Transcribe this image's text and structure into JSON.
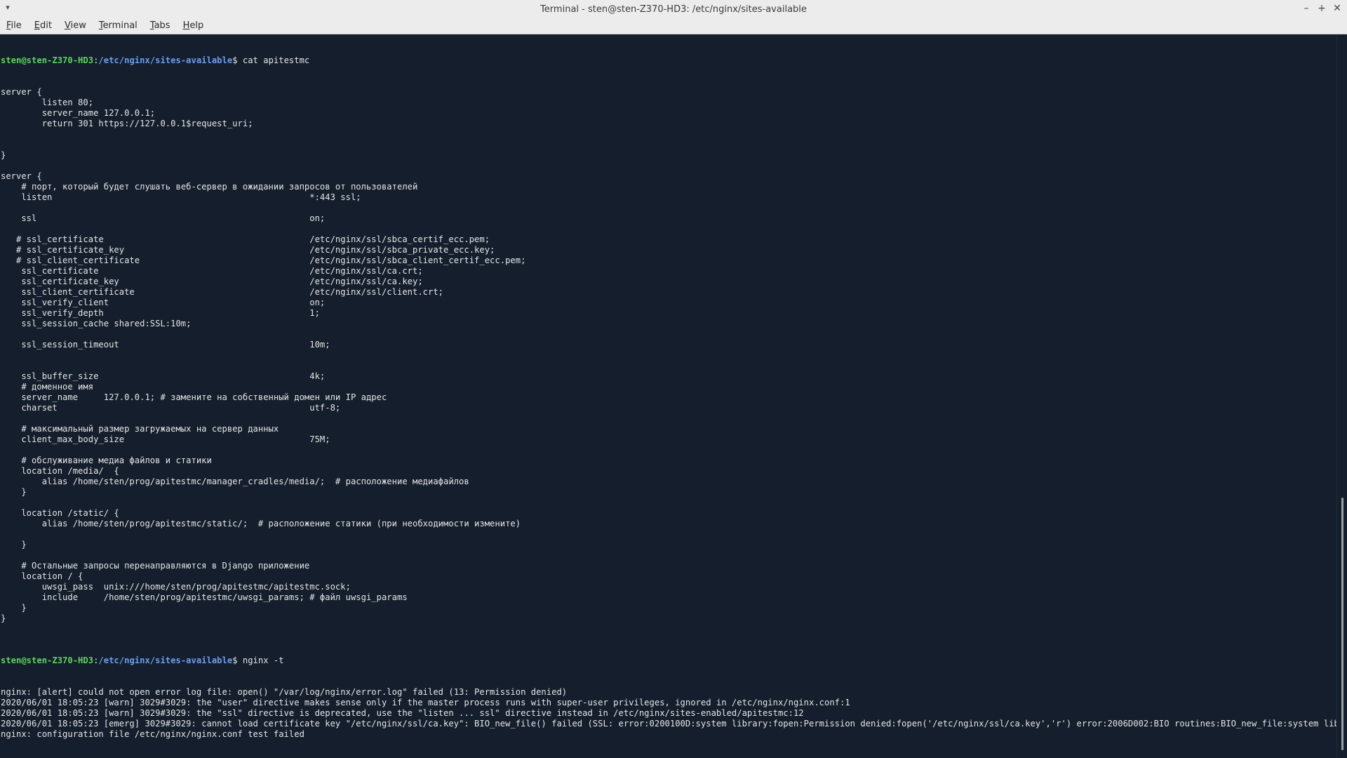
{
  "window": {
    "title": "Terminal - sten@sten-Z370-HD3: /etc/nginx/sites-available",
    "menu_arrow": "▾",
    "minimize": "–",
    "maximize": "+",
    "close": "✕"
  },
  "menubar": {
    "items": [
      {
        "first": "F",
        "rest": "ile"
      },
      {
        "first": "E",
        "rest": "dit"
      },
      {
        "first": "V",
        "rest": "iew"
      },
      {
        "first": "T",
        "rest": "erminal"
      },
      {
        "first": "T",
        "rest": "abs"
      },
      {
        "first": "H",
        "rest": "elp"
      }
    ]
  },
  "prompt": {
    "user": "sten@sten-Z370-HD3",
    "path": "/etc/nginx/sites-available",
    "symbol": "$"
  },
  "commands": {
    "cmd1": " cat apitestmc",
    "cmd2": " nginx -t",
    "cmd3": " "
  },
  "file_lines": [
    "server {",
    "        listen 80;",
    "        server_name 127.0.0.1;",
    "        return 301 https://127.0.0.1$request_uri;",
    "",
    "",
    "}",
    "",
    "server {",
    "    # порт, который будет слушать веб-сервер в ожидании запросов от пользователей",
    "    listen                                                  *:443 ssl;",
    "",
    "    ssl                                                     on;",
    "",
    "   # ssl_certificate                                        /etc/nginx/ssl/sbca_certif_ecc.pem;",
    "   # ssl_certificate_key                                    /etc/nginx/ssl/sbca_private_ecc.key;",
    "   # ssl_client_certificate                                 /etc/nginx/ssl/sbca_client_certif_ecc.pem;",
    "    ssl_certificate                                         /etc/nginx/ssl/ca.crt;",
    "    ssl_certificate_key                                     /etc/nginx/ssl/ca.key;",
    "    ssl_client_certificate                                  /etc/nginx/ssl/client.crt;",
    "    ssl_verify_client                                       on;",
    "    ssl_verify_depth                                        1;",
    "    ssl_session_cache shared:SSL:10m;",
    "",
    "    ssl_session_timeout                                     10m;",
    "",
    "",
    "    ssl_buffer_size                                         4k;",
    "    # доменное имя",
    "    server_name     127.0.0.1; # замените на собственный домен или IP адрес",
    "    charset                                                 utf-8;",
    "",
    "    # максимальный размер загружаемых на сервер данных",
    "    client_max_body_size                                    75M;",
    "",
    "    # обслуживание медиа файлов и статики",
    "    location /media/  {",
    "        alias /home/sten/prog/apitestmc/manager_cradles/media/;  # расположение медиафайлов",
    "    }",
    "",
    "    location /static/ {",
    "        alias /home/sten/prog/apitestmc/static/;  # расположение статики (при необходимости измените)",
    "",
    "    }",
    "",
    "    # Остальные запросы перенаправляются в Django приложение",
    "    location / {",
    "        uwsgi_pass  unix:///home/sten/prog/apitestmc/apitestmc.sock;",
    "        include     /home/sten/prog/apitestmc/uwsgi_params; # файл uwsgi_params",
    "    }",
    "}",
    ""
  ],
  "nginx_output": [
    "nginx: [alert] could not open error log file: open() \"/var/log/nginx/error.log\" failed (13: Permission denied)",
    "2020/06/01 18:05:23 [warn] 3029#3029: the \"user\" directive makes sense only if the master process runs with super-user privileges, ignored in /etc/nginx/nginx.conf:1",
    "2020/06/01 18:05:23 [warn] 3029#3029: the \"ssl\" directive is deprecated, use the \"listen ... ssl\" directive instead in /etc/nginx/sites-enabled/apitestmc:12",
    "2020/06/01 18:05:23 [emerg] 3029#3029: cannot load certificate key \"/etc/nginx/ssl/ca.key\": BIO_new_file() failed (SSL: error:0200100D:system library:fopen:Permission denied:fopen('/etc/nginx/ssl/ca.key','r') error:2006D002:BIO routines:BIO_new_file:system lib)",
    "nginx: configuration file /etc/nginx/nginx.conf test failed"
  ],
  "colors": {
    "background": "#141e2c",
    "prompt_user": "#5fd35f",
    "prompt_path": "#6b9ef0",
    "text": "#e6e6e6"
  }
}
